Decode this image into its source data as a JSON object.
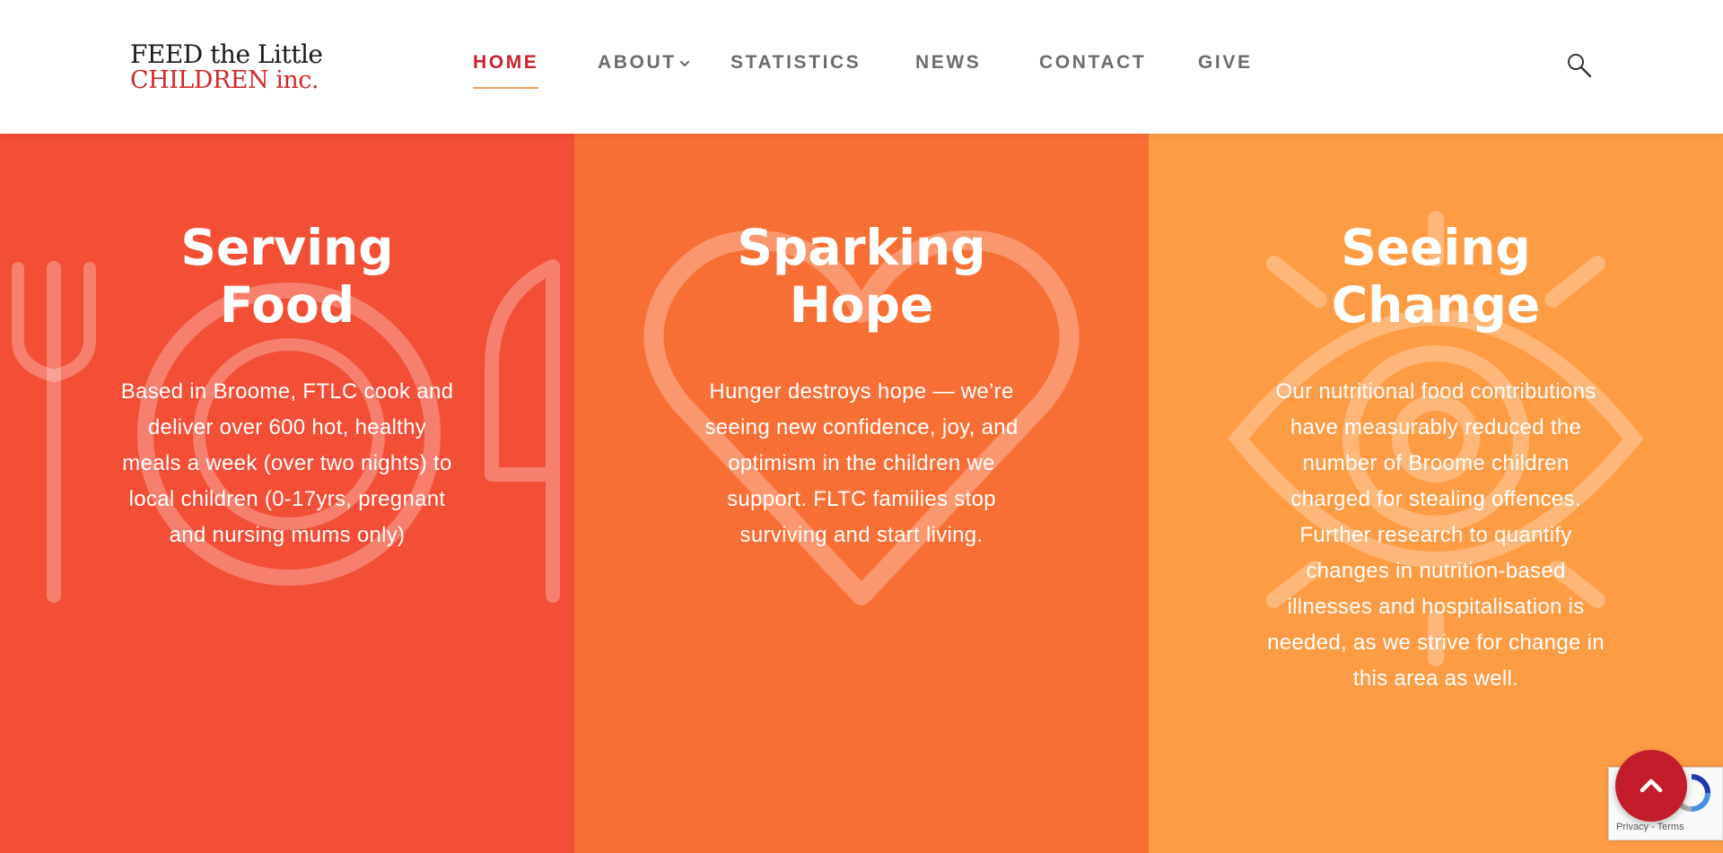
{
  "logo": {
    "line1": "FEED the Little",
    "line2": "CHILDREN inc."
  },
  "nav": {
    "items": [
      {
        "label": "HOME",
        "active": true
      },
      {
        "label": "ABOUT",
        "has_dropdown": true
      },
      {
        "label": "STATISTICS"
      },
      {
        "label": "NEWS"
      },
      {
        "label": "CONTACT"
      },
      {
        "label": "GIVE"
      }
    ],
    "search_icon": "search-icon"
  },
  "columns": [
    {
      "title_line1": "Serving",
      "title_line2": "Food",
      "text": "Based in Broome, FTLC cook and deliver over 600 hot, healthy meals a week (over two nights) to local children (0-17yrs, pregnant and nursing mums only)",
      "icon": "plate-cutlery-icon",
      "color": "#f34e36"
    },
    {
      "title_line1": "Sparking",
      "title_line2": "Hope",
      "text": "Hunger destroys hope — we’re seeing new confidence, joy, and optimism in the children we support. FLTC families stop surviving and start living.",
      "icon": "heart-icon",
      "color": "#f86f36"
    },
    {
      "title_line1": "Seeing",
      "title_line2": "Change",
      "text": "Our nutritional food contributions have measurably reduced the number of Broome children charged for stealing offences. Further research to quantify changes in nutrition-based illnesses and hospitalisation is needed, as we strive for change in this area as well.",
      "icon": "eye-icon",
      "color": "#fe9c45"
    }
  ],
  "back_to_top": {
    "icon": "chevron-up-icon",
    "color": "#c31c2b"
  },
  "recaptcha": {
    "links": "Privacy - Terms"
  },
  "colors": {
    "brand_red": "#c8232c",
    "nav_text": "#6c6c6c",
    "nav_underline": "#f0a35c"
  }
}
